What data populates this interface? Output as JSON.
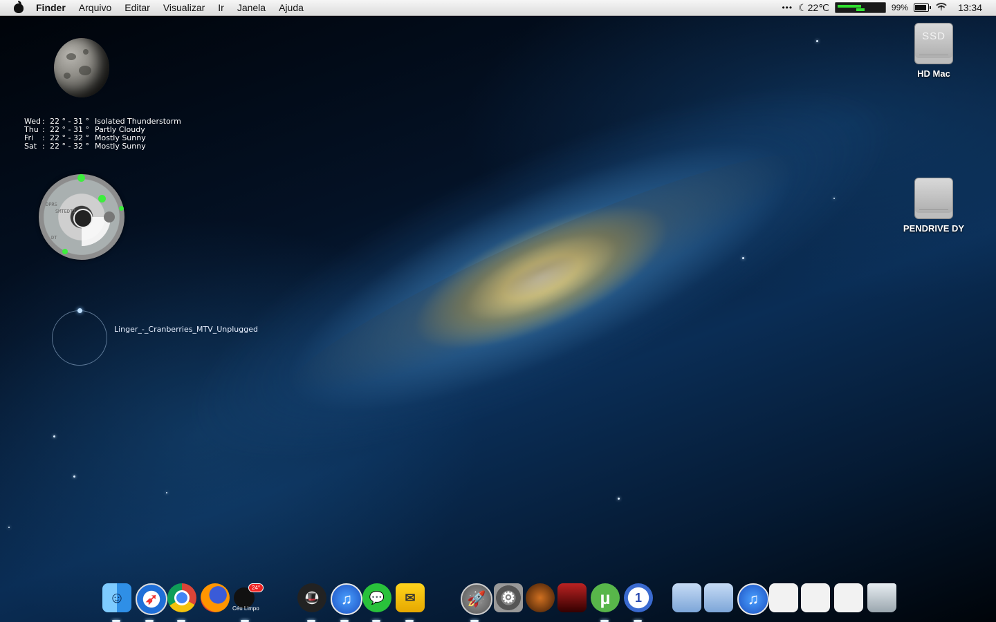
{
  "menubar": {
    "app_name": "Finder",
    "menus": [
      "Arquivo",
      "Editar",
      "Visualizar",
      "Ir",
      "Janela",
      "Ajuda"
    ],
    "status": {
      "more_dots": "•••",
      "temperature": "22℃",
      "battery": "99%",
      "time": "13:34"
    }
  },
  "forecast": [
    {
      "day": "Wed",
      "sep": ":",
      "temp": "22 ° - 31 °",
      "cond": "Isolated Thunderstorm"
    },
    {
      "day": "Thu",
      "sep": ":",
      "temp": "22 ° - 31 °",
      "cond": "Partly Cloudy"
    },
    {
      "day": "Fri",
      "sep": ":",
      "temp": "22 ° - 32 °",
      "cond": "Mostly Sunny"
    },
    {
      "day": "Sat",
      "sep": ":",
      "temp": "22 ° - 32 °",
      "cond": "Mostly Sunny"
    }
  ],
  "dial": {
    "label_top": "DPRS",
    "label_mid": "SMTEDTI",
    "label_bottom": "DT"
  },
  "player": {
    "track": "Linger_-_Cranberries_MTV_Unplugged"
  },
  "drives": [
    {
      "name": "HD Mac",
      "badge": "SSD"
    },
    {
      "name": "PENDRIVE DY"
    }
  ],
  "dock": {
    "weather_label": "Céu Limpo",
    "weather_badge": "24°",
    "calendar_number": "1",
    "colors": {
      "finder": "#2f8fe6",
      "safari": "#1f6fd8",
      "itunes": "#2a6fe0",
      "messages": "#29c23b",
      "utorrent": "#58b64a"
    }
  },
  "icons": {
    "apple": "apple-icon",
    "moon": "moon-icon",
    "battery": "battery-icon",
    "wifi": "wifi-icon",
    "trash": "trash-icon"
  }
}
